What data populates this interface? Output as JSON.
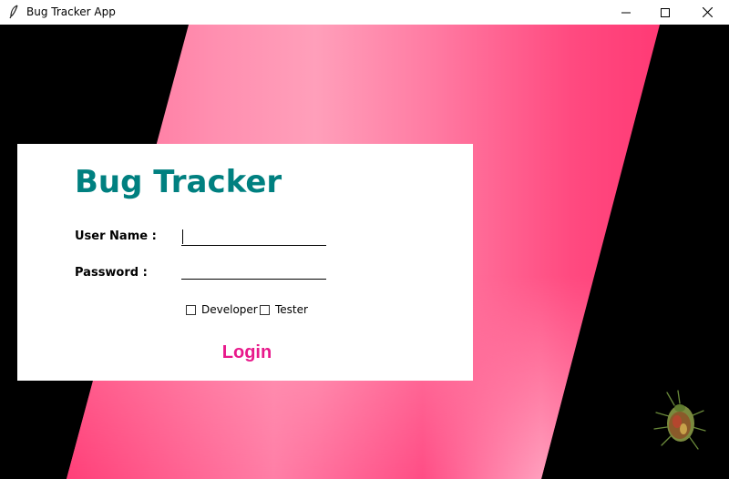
{
  "window": {
    "title": "Bug Tracker App",
    "icon": "feather-icon",
    "controls": [
      "minimize-icon",
      "maximize-icon",
      "close-icon"
    ]
  },
  "login": {
    "heading": "Bug Tracker",
    "username_label": "User Name :",
    "username_value": "",
    "password_label": "Password :",
    "password_value": "",
    "roles": [
      {
        "label": "Developer",
        "checked": false
      },
      {
        "label": "Tester",
        "checked": false
      }
    ],
    "login_button": "Login"
  },
  "decor": {
    "bug_image": "bug-icon"
  },
  "colors": {
    "background": "#000000",
    "stripe_light": "#ff9ab5",
    "stripe_dark": "#ff3e79",
    "heading": "#008080",
    "login_button": "#e8198b",
    "card": "#ffffff"
  }
}
